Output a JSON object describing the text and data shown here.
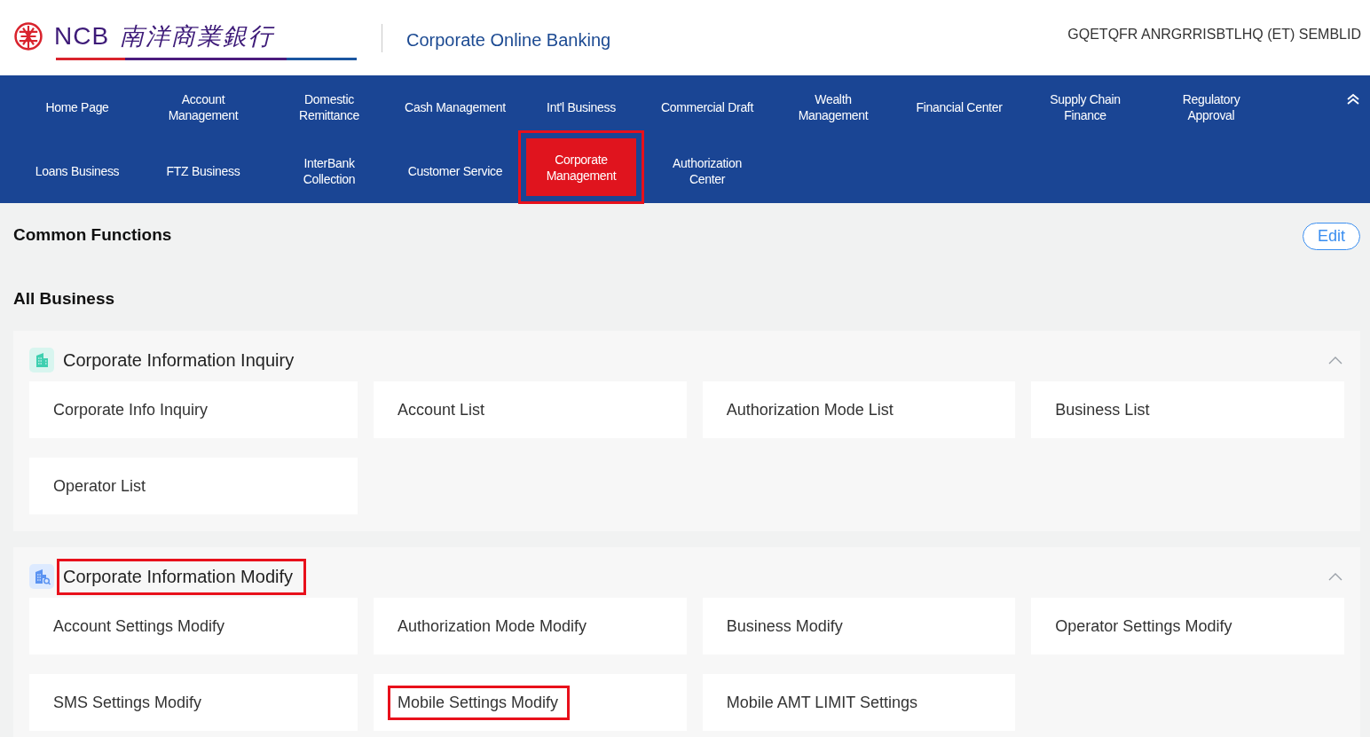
{
  "header": {
    "logo_latin": "NCB",
    "logo_chinese": "南洋商業銀行",
    "title": "Corporate Online Banking",
    "user": "GQETQFR ANRGRRISBTLHQ (ET) SEMBLID"
  },
  "nav": [
    {
      "label": "Home Page",
      "selected": false,
      "annotated": false
    },
    {
      "label": "Account\nManagement",
      "selected": false,
      "annotated": false
    },
    {
      "label": "Domestic\nRemittance",
      "selected": false,
      "annotated": false
    },
    {
      "label": "Cash Management",
      "selected": false,
      "annotated": false
    },
    {
      "label": "Int'l Business",
      "selected": false,
      "annotated": false
    },
    {
      "label": "Commercial Draft",
      "selected": false,
      "annotated": false
    },
    {
      "label": "Wealth\nManagement",
      "selected": false,
      "annotated": false
    },
    {
      "label": "Financial Center",
      "selected": false,
      "annotated": false
    },
    {
      "label": "Supply Chain\nFinance",
      "selected": false,
      "annotated": false
    },
    {
      "label": "Regulatory\nApproval",
      "selected": false,
      "annotated": false
    },
    {
      "label": "Loans Business",
      "selected": false,
      "annotated": false
    },
    {
      "label": "FTZ Business",
      "selected": false,
      "annotated": false
    },
    {
      "label": "InterBank\nCollection",
      "selected": false,
      "annotated": false
    },
    {
      "label": "Customer Service",
      "selected": false,
      "annotated": false
    },
    {
      "label": "Corporate\nManagement",
      "selected": true,
      "annotated": true
    },
    {
      "label": "Authorization\nCenter",
      "selected": false,
      "annotated": false
    }
  ],
  "common_functions": {
    "title": "Common Functions",
    "edit_button": "Edit"
  },
  "all_business": {
    "title": "All Business",
    "sections": [
      {
        "title": "Corporate Information Inquiry",
        "kind": "inquiry",
        "expanded": true,
        "annotated": false,
        "items": [
          {
            "label": "Corporate Info Inquiry",
            "annotated": false
          },
          {
            "label": "Account List",
            "annotated": false
          },
          {
            "label": "Authorization Mode List",
            "annotated": false
          },
          {
            "label": "Business List",
            "annotated": false
          },
          {
            "label": "Operator List",
            "annotated": false
          }
        ]
      },
      {
        "title": "Corporate Information Modify",
        "kind": "modify",
        "expanded": true,
        "annotated": true,
        "items": [
          {
            "label": "Account Settings Modify",
            "annotated": false
          },
          {
            "label": "Authorization Mode Modify",
            "annotated": false
          },
          {
            "label": "Business Modify",
            "annotated": false
          },
          {
            "label": "Operator Settings Modify",
            "annotated": false
          },
          {
            "label": "SMS Settings Modify",
            "annotated": false
          },
          {
            "label": "Mobile Settings Modify",
            "annotated": true
          },
          {
            "label": "Mobile AMT LIMIT Settings",
            "annotated": false
          }
        ]
      }
    ]
  }
}
